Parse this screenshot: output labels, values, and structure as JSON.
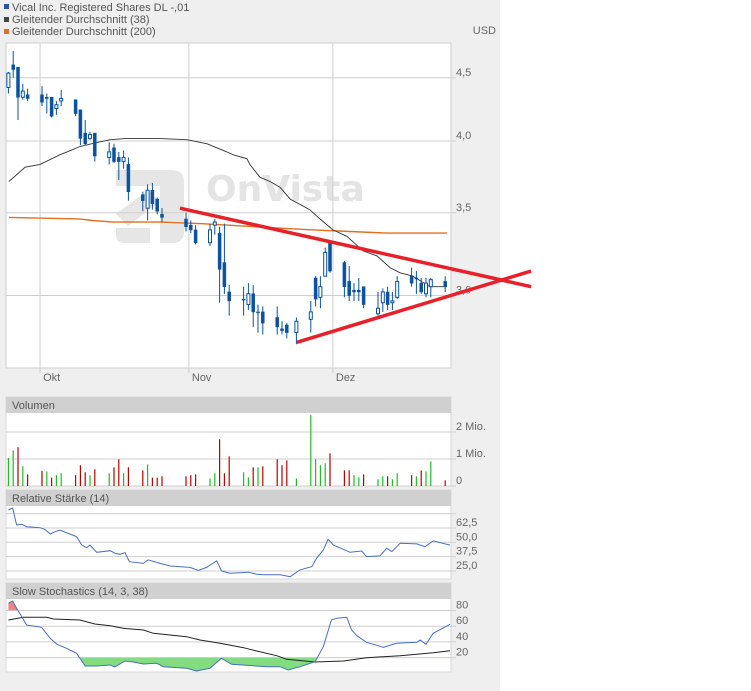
{
  "legend": [
    {
      "label": "Vical Inc. Registered Shares DL -,01",
      "color": "#1a5aa8"
    },
    {
      "label": "Gleitender Durchschnitt (38)",
      "color": "#444444"
    },
    {
      "label": "Gleitender Durchschnitt (200)",
      "color": "#e07020"
    }
  ],
  "currency": "USD",
  "watermark": "OnVista",
  "chart_data": {
    "type": "candlestick",
    "price_axis": {
      "ticks": [
        4.5,
        4.0,
        3.5,
        3.0
      ],
      "labels": [
        "4,5",
        "4,0",
        "3,5",
        "3,0"
      ],
      "scale": "log"
    },
    "x_axis": {
      "labels": [
        {
          "text": "Okt",
          "day": -0.4
        },
        {
          "text": "Nov",
          "day": 30.6
        },
        {
          "text": "Dez",
          "day": 60.6
        }
      ],
      "unit": "calendar days since Oct 1"
    },
    "candles_fields": [
      "day",
      "open",
      "high",
      "low",
      "close",
      "volume_mio",
      "volume_color"
    ],
    "candles": [
      [
        -7,
        4.42,
        4.55,
        4.37,
        4.54,
        1.04,
        "g"
      ],
      [
        -6,
        4.61,
        4.73,
        4.5,
        4.57,
        1.32,
        "g"
      ],
      [
        -5,
        4.59,
        4.59,
        4.16,
        4.34,
        1.44,
        "r"
      ],
      [
        -4,
        4.34,
        4.45,
        4.32,
        4.39,
        0.73,
        "g"
      ],
      [
        -3,
        4.36,
        4.41,
        4.31,
        4.33,
        0.43,
        "r"
      ],
      [
        0,
        4.36,
        4.43,
        4.27,
        4.3,
        0.56,
        "r"
      ],
      [
        1,
        4.34,
        4.37,
        4.21,
        4.33,
        0.54,
        "g"
      ],
      [
        2,
        4.34,
        4.34,
        4.18,
        4.19,
        0.31,
        "r"
      ],
      [
        3,
        4.25,
        4.31,
        4.2,
        4.28,
        0.4,
        "g"
      ],
      [
        4,
        4.31,
        4.4,
        4.27,
        4.33,
        0.47,
        "g"
      ],
      [
        7,
        4.32,
        4.32,
        4.19,
        4.21,
        0.4,
        "r"
      ],
      [
        8,
        4.24,
        4.24,
        3.97,
        4.02,
        0.77,
        "r"
      ],
      [
        9,
        4.06,
        4.16,
        3.97,
        3.98,
        0.51,
        "r"
      ],
      [
        10,
        4.02,
        4.07,
        4.01,
        4.05,
        0.4,
        "g"
      ],
      [
        11,
        4.06,
        4.06,
        3.85,
        3.89,
        0.62,
        "r"
      ],
      [
        14,
        3.88,
        3.99,
        3.83,
        3.92,
        0.47,
        "g"
      ],
      [
        15,
        3.95,
        3.98,
        3.84,
        3.85,
        0.69,
        "r"
      ],
      [
        16,
        3.88,
        3.92,
        3.72,
        3.85,
        0.99,
        "r"
      ],
      [
        17,
        3.85,
        3.93,
        3.8,
        3.88,
        0.47,
        "g"
      ],
      [
        18,
        3.83,
        3.88,
        3.58,
        3.64,
        0.69,
        "r"
      ],
      [
        21,
        3.62,
        3.64,
        3.51,
        3.58,
        0.58,
        "r"
      ],
      [
        22,
        3.53,
        3.69,
        3.45,
        3.65,
        0.8,
        "g"
      ],
      [
        23,
        3.65,
        3.7,
        3.52,
        3.56,
        0.31,
        "r"
      ],
      [
        24,
        3.59,
        3.6,
        3.49,
        3.51,
        0.31,
        "r"
      ],
      [
        25,
        3.49,
        3.53,
        3.44,
        3.47,
        0.36,
        "r"
      ],
      [
        30,
        3.46,
        3.5,
        3.38,
        3.41,
        0.36,
        "r"
      ],
      [
        31,
        3.42,
        3.45,
        3.37,
        3.39,
        0.4,
        "r"
      ],
      [
        32,
        3.39,
        3.42,
        3.3,
        3.31,
        0.43,
        "r"
      ],
      [
        35,
        3.31,
        3.43,
        3.29,
        3.39,
        0.28,
        "g"
      ],
      [
        36,
        3.42,
        3.46,
        3.36,
        3.44,
        0.47,
        "g"
      ],
      [
        37,
        3.37,
        3.41,
        2.96,
        3.15,
        1.73,
        "r"
      ],
      [
        38,
        3.19,
        3.43,
        3.01,
        3.05,
        0.47,
        "r"
      ],
      [
        39,
        3.02,
        3.06,
        2.89,
        2.97,
        1.1,
        "r"
      ],
      [
        42,
        2.98,
        3.05,
        2.89,
        2.98,
        0.51,
        "g"
      ],
      [
        43,
        2.95,
        3.07,
        2.92,
        3.01,
        0.32,
        "g"
      ],
      [
        44,
        3.01,
        3.06,
        2.83,
        2.91,
        0.69,
        "r"
      ],
      [
        45,
        2.91,
        2.95,
        2.8,
        2.91,
        0.69,
        "g"
      ],
      [
        46,
        2.91,
        2.94,
        2.79,
        2.85,
        0.73,
        "r"
      ],
      [
        49,
        2.88,
        2.94,
        2.79,
        2.83,
        0.99,
        "r"
      ],
      [
        50,
        2.82,
        2.86,
        2.79,
        2.81,
        0.77,
        "r"
      ],
      [
        51,
        2.84,
        2.85,
        2.77,
        2.8,
        0.95,
        "r"
      ],
      [
        53,
        2.8,
        2.88,
        2.74,
        2.86,
        0.28,
        "g"
      ],
      [
        56,
        2.87,
        2.97,
        2.8,
        2.91,
        2.62,
        "g"
      ],
      [
        57,
        3.1,
        3.11,
        2.94,
        2.98,
        0.99,
        "g"
      ],
      [
        58,
        2.99,
        3.11,
        2.93,
        3.05,
        0.77,
        "g"
      ],
      [
        59,
        3.11,
        3.28,
        3.11,
        3.25,
        0.84,
        "g"
      ],
      [
        60,
        3.31,
        3.32,
        3.13,
        3.14,
        1.21,
        "r"
      ],
      [
        63,
        3.19,
        3.2,
        2.99,
        3.05,
        0.58,
        "r"
      ],
      [
        64,
        3.08,
        3.17,
        2.97,
        3.0,
        0.58,
        "r"
      ],
      [
        65,
        3.03,
        3.07,
        2.97,
        3.02,
        0.4,
        "g"
      ],
      [
        66,
        3.03,
        3.1,
        2.97,
        3.02,
        0.32,
        "g"
      ],
      [
        67,
        3.05,
        3.05,
        2.93,
        2.95,
        0.43,
        "r"
      ],
      [
        70,
        2.9,
        3.02,
        2.89,
        2.93,
        0.25,
        "g"
      ],
      [
        71,
        2.96,
        3.04,
        2.91,
        3.02,
        0.36,
        "g"
      ],
      [
        72,
        3.02,
        3.05,
        2.92,
        2.95,
        0.36,
        "r"
      ],
      [
        73,
        2.96,
        3.02,
        2.92,
        2.97,
        0.25,
        "g"
      ],
      [
        74,
        2.99,
        3.11,
        2.98,
        3.08,
        0.47,
        "g"
      ],
      [
        77,
        3.11,
        3.16,
        3.05,
        3.07,
        0.4,
        "r"
      ],
      [
        78,
        3.1,
        3.14,
        3.01,
        3.1,
        0.36,
        "g"
      ],
      [
        79,
        3.07,
        3.1,
        3.01,
        3.02,
        0.58,
        "r"
      ],
      [
        80,
        3.01,
        3.1,
        2.99,
        3.07,
        0.54,
        "g"
      ],
      [
        81,
        3.05,
        3.1,
        2.99,
        3.09,
        0.91,
        "g"
      ],
      [
        84,
        3.08,
        3.11,
        3.02,
        3.05,
        0.21,
        "r"
      ]
    ],
    "ma38": [
      [
        -6.9,
        3.71
      ],
      [
        -3.5,
        3.81
      ],
      [
        -0.4,
        3.83
      ],
      [
        3.75,
        3.9
      ],
      [
        5.2,
        3.92
      ],
      [
        7.9,
        3.96
      ],
      [
        11.5,
        3.99
      ],
      [
        14.2,
        4.01
      ],
      [
        17.7,
        4.02
      ],
      [
        24,
        4.02
      ],
      [
        30.2,
        4.01
      ],
      [
        34.4,
        3.98
      ],
      [
        38.5,
        3.92
      ],
      [
        39.8,
        3.9
      ],
      [
        42.7,
        3.87
      ],
      [
        43.3,
        3.83
      ],
      [
        45.4,
        3.74
      ],
      [
        47.5,
        3.71
      ],
      [
        49.6,
        3.67
      ],
      [
        51.7,
        3.59
      ],
      [
        55.8,
        3.52
      ],
      [
        57.9,
        3.46
      ],
      [
        60.6,
        3.39
      ],
      [
        63.5,
        3.35
      ],
      [
        66.9,
        3.26
      ],
      [
        69.8,
        3.23
      ],
      [
        72.5,
        3.16
      ],
      [
        74.6,
        3.13
      ],
      [
        77.3,
        3.11
      ],
      [
        80.8,
        3.05
      ],
      [
        84.4,
        3.05
      ]
    ],
    "ma200": [
      [
        -6.9,
        3.47
      ],
      [
        7.7,
        3.46
      ],
      [
        10.6,
        3.45
      ],
      [
        14.8,
        3.44
      ],
      [
        24.6,
        3.44
      ],
      [
        32.9,
        3.43
      ],
      [
        50.2,
        3.4
      ],
      [
        56.5,
        3.39
      ],
      [
        64.2,
        3.38
      ],
      [
        71.9,
        3.37
      ],
      [
        84.4,
        3.37
      ]
    ],
    "trendlines": [
      {
        "from": [
          28.75,
          3.53
        ],
        "to": [
          101.9,
          3.05
        ],
        "color": "#e8202a"
      },
      {
        "from": [
          53.1,
          2.75
        ],
        "to": [
          101.9,
          3.14
        ],
        "color": "#e8202a"
      }
    ],
    "volume_panel": {
      "title": "Volumen",
      "ticks": [
        2,
        1,
        0
      ],
      "labels": [
        "2 Mio.",
        "1 Mio.",
        "0"
      ]
    },
    "rsi_panel": {
      "title": "Relative Stärke (14)",
      "ticks": [
        62.5,
        50,
        37.5,
        25
      ],
      "labels": [
        "62,5",
        "50,0",
        "37,5",
        "25,0"
      ],
      "grid": [
        75,
        62.5,
        50,
        37.5,
        25
      ],
      "values": [
        [
          -7,
          78.2
        ],
        [
          -6.1,
          79.9
        ],
        [
          -5.3,
          65.1
        ],
        [
          -4.2,
          65.7
        ],
        [
          -3.2,
          63.6
        ],
        [
          -0.4,
          62.7
        ],
        [
          0.6,
          61.3
        ],
        [
          1.7,
          57.2
        ],
        [
          2.7,
          59.2
        ],
        [
          3.75,
          60.6
        ],
        [
          5.8,
          57.2
        ],
        [
          7.2,
          54.9
        ],
        [
          8.3,
          47.6
        ],
        [
          9.3,
          45.3
        ],
        [
          10,
          47.6
        ],
        [
          11.4,
          41.3
        ],
        [
          14.2,
          42.7
        ],
        [
          15.2,
          40.4
        ],
        [
          16.25,
          39.5
        ],
        [
          17.3,
          41.0
        ],
        [
          18.2,
          33.1
        ],
        [
          21.1,
          31.6
        ],
        [
          22.1,
          34.6
        ],
        [
          24.6,
          31.6
        ],
        [
          26.7,
          29.3
        ],
        [
          30.8,
          28.1
        ],
        [
          32.6,
          25.6
        ],
        [
          34.3,
          28.1
        ],
        [
          36.4,
          33.9
        ],
        [
          37.4,
          25.0
        ],
        [
          39.2,
          23.0
        ],
        [
          43,
          23.9
        ],
        [
          44.7,
          22.2
        ],
        [
          46.1,
          21.6
        ],
        [
          49.6,
          21.6
        ],
        [
          51.7,
          20.0
        ],
        [
          53.75,
          25.9
        ],
        [
          56.2,
          28.8
        ],
        [
          57.2,
          36.0
        ],
        [
          58.6,
          43.3
        ],
        [
          59.6,
          52.6
        ],
        [
          60.7,
          47.6
        ],
        [
          64.2,
          41.3
        ],
        [
          66.6,
          42.4
        ],
        [
          67.6,
          37.5
        ],
        [
          70.4,
          38.1
        ],
        [
          71.8,
          44.8
        ],
        [
          72.9,
          41.9
        ],
        [
          74.6,
          49.2
        ],
        [
          78.1,
          48.6
        ],
        [
          79.8,
          46.2
        ],
        [
          81.5,
          51.2
        ],
        [
          85,
          47.6
        ]
      ]
    },
    "stoch_panel": {
      "title": "Slow Stochastics (14, 3, 38)",
      "ticks": [
        80,
        60,
        40,
        20
      ],
      "labels": [
        "80",
        "60",
        "40",
        "20"
      ],
      "k": [
        [
          -7,
          89.2
        ],
        [
          -6.1,
          92.1
        ],
        [
          -5.3,
          82.8
        ],
        [
          -4.2,
          72.1
        ],
        [
          -3.2,
          61.5
        ],
        [
          -0.1,
          58.6
        ],
        [
          1.7,
          44.6
        ],
        [
          3.1,
          36.9
        ],
        [
          5.1,
          31.8
        ],
        [
          7.2,
          25.5
        ],
        [
          9,
          9.3
        ],
        [
          11.4,
          9.3
        ],
        [
          14.2,
          10.6
        ],
        [
          15.2,
          8.0
        ],
        [
          17.3,
          15.7
        ],
        [
          19,
          14.4
        ],
        [
          21.1,
          11.8
        ],
        [
          23.9,
          12.7
        ],
        [
          25.3,
          8.4
        ],
        [
          30.1,
          6.4
        ],
        [
          32.2,
          2.9
        ],
        [
          35,
          6.4
        ],
        [
          37.4,
          19.1
        ],
        [
          39.5,
          11.5
        ],
        [
          42.6,
          10.2
        ],
        [
          46.8,
          8.4
        ],
        [
          49.6,
          8.4
        ],
        [
          51.3,
          4.2
        ],
        [
          53.75,
          8.4
        ],
        [
          56.9,
          14.8
        ],
        [
          58.6,
          33.9
        ],
        [
          60.3,
          67.9
        ],
        [
          61.4,
          70
        ],
        [
          63.5,
          71.3
        ],
        [
          64.5,
          55.2
        ],
        [
          65.6,
          47.9
        ],
        [
          67.6,
          39.5
        ],
        [
          71.1,
          33.1
        ],
        [
          73.9,
          38.2
        ],
        [
          78.1,
          39.5
        ],
        [
          78.8,
          42.4
        ],
        [
          80,
          36.9
        ],
        [
          81.5,
          51
        ],
        [
          85,
          62.4
        ]
      ],
      "d": [
        [
          -7,
          67.9
        ],
        [
          -3.9,
          71.3
        ],
        [
          1,
          71.3
        ],
        [
          2.4,
          69.2
        ],
        [
          7.9,
          67.9
        ],
        [
          11,
          62.8
        ],
        [
          14.2,
          60.6
        ],
        [
          16.9,
          57.3
        ],
        [
          21.1,
          55.2
        ],
        [
          23.2,
          51
        ],
        [
          30.1,
          46.6
        ],
        [
          32.9,
          42.4
        ],
        [
          37.1,
          38.2
        ],
        [
          42,
          32.6
        ],
        [
          44.7,
          28.4
        ],
        [
          48.9,
          22.4
        ],
        [
          51,
          17.8
        ],
        [
          56.9,
          14.4
        ],
        [
          62.8,
          15.7
        ],
        [
          67.6,
          19.9
        ],
        [
          74.6,
          22.4
        ],
        [
          81.5,
          26.2
        ],
        [
          85,
          28.8
        ]
      ],
      "overbought": 80,
      "oversold": 20
    },
    "colors": {
      "candle": "#0a52a0",
      "ma38": "#333333",
      "ma200": "#e07020",
      "trend": "#e8202a",
      "vol_up": "#22bb22",
      "vol_down": "#bb0000",
      "indicator": "#4a6fc0",
      "ob_fill": "#f08585",
      "os_fill": "#80dd80"
    }
  }
}
